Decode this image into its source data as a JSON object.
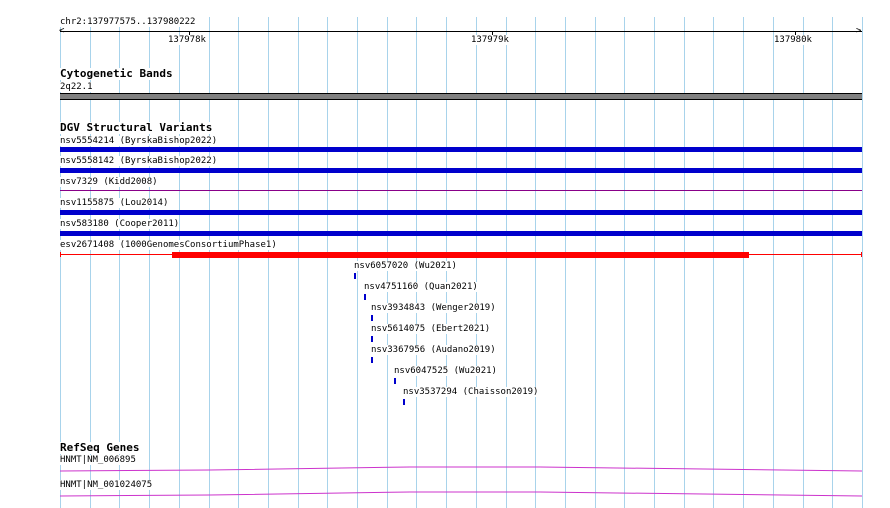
{
  "ruler": {
    "location": "chr2:137977575..137980222",
    "ticks": [
      {
        "label": "137978k",
        "pos": 137978000
      },
      {
        "label": "137979k",
        "pos": 137979000
      },
      {
        "label": "137980k",
        "pos": 137980000
      }
    ],
    "start": 137977575,
    "end": 137980222
  },
  "cytoband": {
    "title": "Cytogenetic Bands",
    "band_label": "2q22.1",
    "color": "#808080"
  },
  "dgv": {
    "title": "DGV Structural Variants",
    "colors": {
      "loss": "#0000cc",
      "gain": "#ff0000",
      "complex": "#880088"
    },
    "variants": [
      {
        "label": "nsv5554214 (ByrskaBishop2022)",
        "type": "loss",
        "style": "thick"
      },
      {
        "label": "nsv5558142 (ByrskaBishop2022)",
        "type": "loss",
        "style": "thick"
      },
      {
        "label": "nsv7329 (Kidd2008)",
        "type": "complex",
        "style": "thin"
      },
      {
        "label": "nsv1155875 (Lou2014)",
        "type": "loss",
        "style": "thick"
      },
      {
        "label": "nsv583180 (Cooper2011)",
        "type": "loss",
        "style": "thick"
      },
      {
        "label": "esv2671408 (1000GenomesConsortiumPhase1)",
        "type": "gain",
        "style": "thick"
      },
      {
        "label": "nsv6057020 (Wu2021)",
        "type": "loss",
        "style": "small"
      },
      {
        "label": "nsv4751160 (Quan2021)",
        "type": "loss",
        "style": "small"
      },
      {
        "label": "nsv3934843 (Wenger2019)",
        "type": "loss",
        "style": "small"
      },
      {
        "label": "nsv5614075 (Ebert2021)",
        "type": "loss",
        "style": "small"
      },
      {
        "label": "nsv3367956 (Audano2019)",
        "type": "loss",
        "style": "small"
      },
      {
        "label": "nsv6047525 (Wu2021)",
        "type": "loss",
        "style": "small"
      },
      {
        "label": "nsv3537294 (Chaisson2019)",
        "type": "loss",
        "style": "small"
      }
    ]
  },
  "refseq": {
    "title": "RefSeq Genes",
    "color": "#cc33cc",
    "genes": [
      {
        "label": "HNMT|NM_006895"
      },
      {
        "label": "HNMT|NM_001024075"
      }
    ]
  }
}
